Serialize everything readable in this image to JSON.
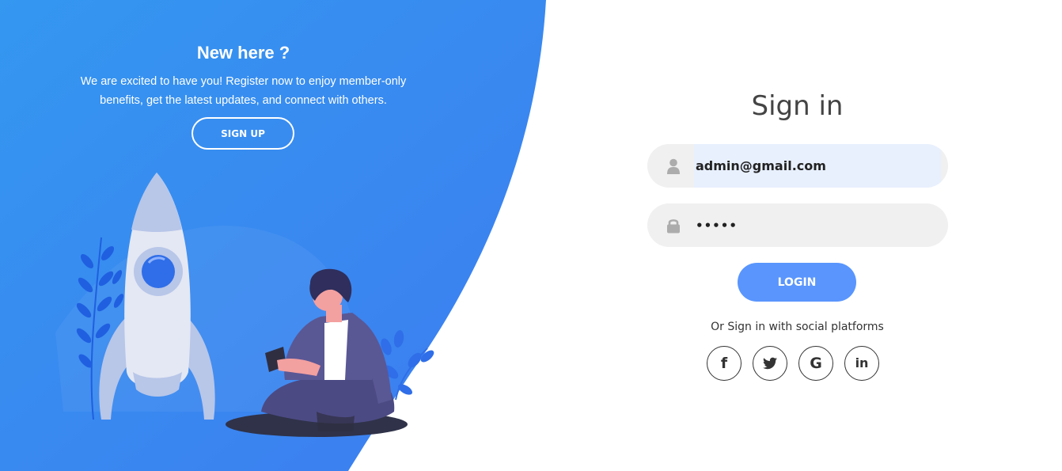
{
  "left_panel": {
    "title": "New here ?",
    "text": "We are excited to have you! Register now to enjoy member-only benefits, get the latest updates, and connect with others.",
    "signup_label": "SIGN UP"
  },
  "signin": {
    "title": "Sign in",
    "email": {
      "value": "admin@gmail.com",
      "icon": "user-icon"
    },
    "password": {
      "value": "•••••",
      "icon": "lock-icon"
    },
    "login_label": "LOGIN",
    "social_text": "Or Sign in with social platforms",
    "social": [
      {
        "name": "facebook-icon",
        "glyph": "f"
      },
      {
        "name": "twitter-icon",
        "glyph": ""
      },
      {
        "name": "google-icon",
        "glyph": "G"
      },
      {
        "name": "linkedin-icon",
        "glyph": "in"
      }
    ]
  },
  "colors": {
    "panel_gradient_start": "#3497f0",
    "panel_gradient_end": "#3d7cf0",
    "login_button": "#5995fd",
    "input_bg": "#f0f0f0",
    "autofill_bg": "#e8f0fe",
    "text": "#333333"
  }
}
